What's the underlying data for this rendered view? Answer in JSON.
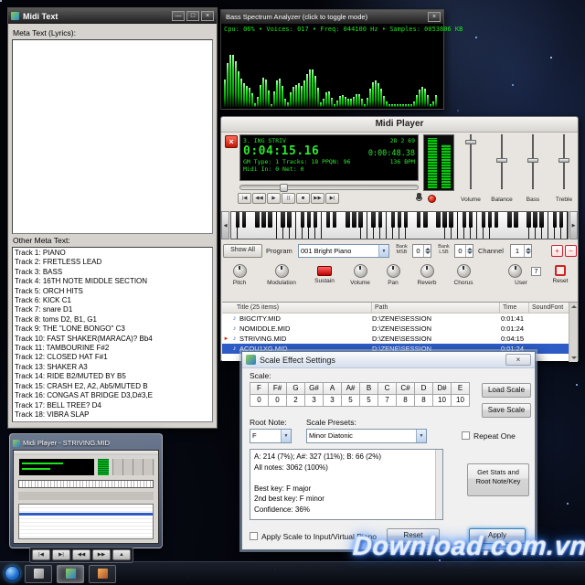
{
  "icons": {
    "minimize": "—",
    "maximize": "□",
    "close": "×",
    "dropdown": "▼",
    "note": "♪",
    "now_playing": "►",
    "scroll_left": "◀",
    "scroll_right": "▶",
    "plus": "+",
    "minus": "−"
  },
  "midi_text_window": {
    "title": "Midi Text",
    "meta_text_label": "Meta Text (Lyrics):",
    "other_meta_label": "Other Meta Text:",
    "tracks": [
      "Track 1: PIANO",
      "Track 2: FRETLESS LEAD",
      "Track 3: BASS",
      "Track 4: 16TH NOTE MIDDLE SECTION",
      "Track 5: ORCH HITS",
      "Track 6: KICK C1",
      "Track 7: snare D1",
      "Track 8: toms D2, B1, G1",
      "Track 9: THE \"LONE BONGO\" C3",
      "Track 10: FAST SHAKER(MARACA)? Bb4",
      "Track 11: TAMBOURINE F#2",
      "Track 12: CLOSED HAT F#1",
      "Track 13: SHAKER A3",
      "Track 14: RIDE B2/MUTED BY B5",
      "Track 15: CRASH E2, A2, Ab5/MUTED B",
      "Track 16: CONGAS AT BRIDGE D3,D#3,E",
      "Track 17: BELL TREE? D4",
      "Track 18: VIBRA SLAP"
    ]
  },
  "spectrum_window": {
    "title": "Bass Spectrum Analyzer (click to toggle mode)",
    "status": "Cpu: 06% • Voices: 017 • Freq: 044100 Hz • Samples: 0053806 KB"
  },
  "midi_player": {
    "title": "Midi Player",
    "display": {
      "track_scroll": "3. ING  STRIV",
      "counters": "28  2  69",
      "time_main": "0:04:15.16",
      "time_sub": "0:00:48.38",
      "meta": "GM  Type: 1  Tracks: 18  PPQN: 96",
      "bpm": "136 BPM",
      "io": "Midi In: 0   Net: 0"
    },
    "transport": [
      "|◀",
      "◀◀",
      "▶",
      "||",
      "■",
      "▶▶",
      "▶|"
    ],
    "mixer_labels": [
      "Volume",
      "Balance",
      "Bass",
      "Treble"
    ],
    "program_row": {
      "show_all": "Show All",
      "program_label": "Program",
      "program_value": "001 Bright Piano",
      "bank_msb_label": "Bank MSB",
      "bank_msb_value": "0",
      "bank_lsb_label": "Bank LSB",
      "bank_lsb_value": "0",
      "channel_label": "Channel",
      "channel_value": "1"
    },
    "knobs": [
      "Pitch",
      "Modulation",
      "Sustain",
      "Volume",
      "Pan",
      "Reverb",
      "Chorus",
      "User",
      "Reset"
    ],
    "user_value": "7",
    "playlist": {
      "columns": [
        "Title  (25 items)",
        "Path",
        "Time",
        "SoundFont"
      ],
      "rows": [
        {
          "title": "BIGCITY.MID",
          "path": "D:\\ZENE\\SESSION",
          "time": "0:01:41"
        },
        {
          "title": "NOMIDDLE.MID",
          "path": "D:\\ZENE\\SESSION",
          "time": "0:01:24"
        },
        {
          "title": "STRIVING.MID",
          "path": "D:\\ZENE\\SESSION",
          "time": "0:04:15"
        },
        {
          "title": "ACOU1XG.MID",
          "path": "D:\\ZENE\\SESSION",
          "time": "0:01:24"
        }
      ]
    }
  },
  "scale_dialog": {
    "title": "Scale Effect Settings",
    "scale_label": "Scale:",
    "notes": [
      "F",
      "F#",
      "G",
      "G#",
      "A",
      "A#",
      "B",
      "C",
      "C#",
      "D",
      "D#",
      "E"
    ],
    "values": [
      "0",
      "0",
      "2",
      "3",
      "3",
      "5",
      "5",
      "7",
      "8",
      "8",
      "10",
      "10"
    ],
    "load_button": "Load Scale",
    "save_button": "Save Scale",
    "root_note_label": "Root Note:",
    "root_note_value": "F",
    "presets_label": "Scale Presets:",
    "presets_value": "Minor Diatonic",
    "repeat_one_label": "Repeat One",
    "stats_lines": [
      "A: 214 (7%);  A#: 327 (11%);  B: 66 (2%)",
      "All notes: 3062 (100%)",
      "",
      "Best key: F major",
      "2nd best key: F minor",
      "Confidence: 36%"
    ],
    "get_stats_button": "Get Stats and Root Note/Key",
    "apply_scale_label": "Apply Scale to Input/Virtual Piano",
    "reset_button": "Reset",
    "apply_button": "Apply"
  },
  "preview_window": {
    "title": "Midi Player - STRIVING.MID"
  },
  "media_toolbar": [
    "|◀",
    "▶|",
    "◀◀",
    "▶▶",
    "▲"
  ],
  "watermark": "Download.com.vn"
}
